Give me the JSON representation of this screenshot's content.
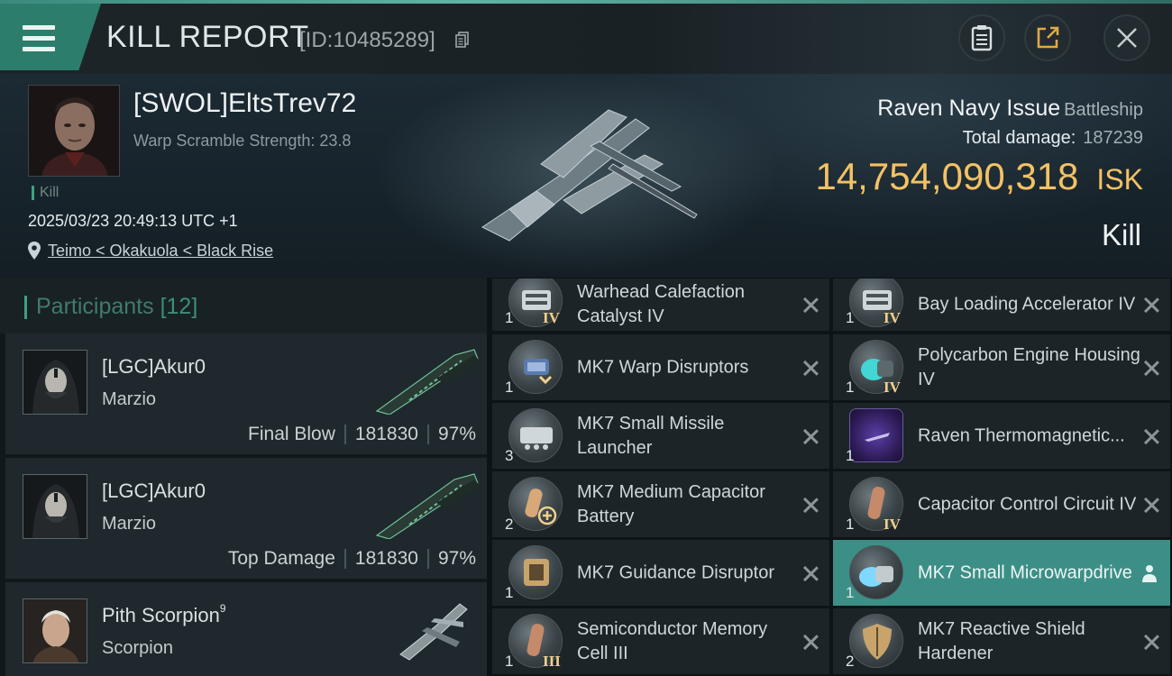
{
  "header": {
    "title": "KILL REPORT",
    "report_id": "[ID:10485289]"
  },
  "victim": {
    "pilot": "[SWOL]EltsTrev72",
    "warp_scramble": "Warp Scramble Strength: 23.8",
    "tag": "Kill",
    "timestamp": "2025/03/23 20:49:13 UTC +1",
    "location": "Teimo < Okakuola < Black Rise",
    "ship_name": "Raven Navy Issue",
    "ship_class": "Battleship",
    "total_damage_label": "Total damage:",
    "total_damage": "187239",
    "isk_value": "14,754,090,318",
    "isk_unit": "ISK",
    "result": "Kill"
  },
  "participants": {
    "title": "Participants",
    "count": "[12]",
    "items": [
      {
        "name": "[LGC]Akur0",
        "ship": "Marzio",
        "role": "Final Blow",
        "damage": "181830",
        "percent": "97%"
      },
      {
        "name": "[LGC]Akur0",
        "ship": "Marzio",
        "role": "Top Damage",
        "damage": "181830",
        "percent": "97%"
      },
      {
        "name": "Pith Scorpion",
        "sup": "9",
        "ship": "Scorpion"
      }
    ]
  },
  "modules": {
    "left": [
      {
        "name": "Warhead Calefaction Catalyst IV",
        "qty": "1",
        "tier": "IV"
      },
      {
        "name": "MK7 Warp Disruptors",
        "qty": "1",
        "tier": ""
      },
      {
        "name": "MK7 Small Missile Launcher",
        "qty": "3",
        "tier": ""
      },
      {
        "name": "MK7 Medium Capacitor Battery",
        "qty": "2",
        "tier": ""
      },
      {
        "name": "MK7 Guidance Disruptor",
        "qty": "1",
        "tier": ""
      },
      {
        "name": "Semiconductor Memory Cell III",
        "qty": "1",
        "tier": "III"
      }
    ],
    "right": [
      {
        "name": "Bay Loading Accelerator IV",
        "qty": "1",
        "tier": "IV"
      },
      {
        "name": "Polycarbon Engine Housing IV",
        "qty": "1",
        "tier": "IV"
      },
      {
        "name": "Raven Thermomagnetic...",
        "qty": "1",
        "tier": ""
      },
      {
        "name": "Capacitor Control Circuit IV",
        "qty": "1",
        "tier": "IV"
      },
      {
        "name": "MK7 Small Microwarpdrive",
        "qty": "1",
        "tier": ""
      },
      {
        "name": "MK7 Reactive Shield Hardener",
        "qty": "2",
        "tier": ""
      }
    ]
  },
  "colors": {
    "accent": "#2c7d6b",
    "isk": "#f3c265",
    "active_module": "#3c8f86"
  }
}
